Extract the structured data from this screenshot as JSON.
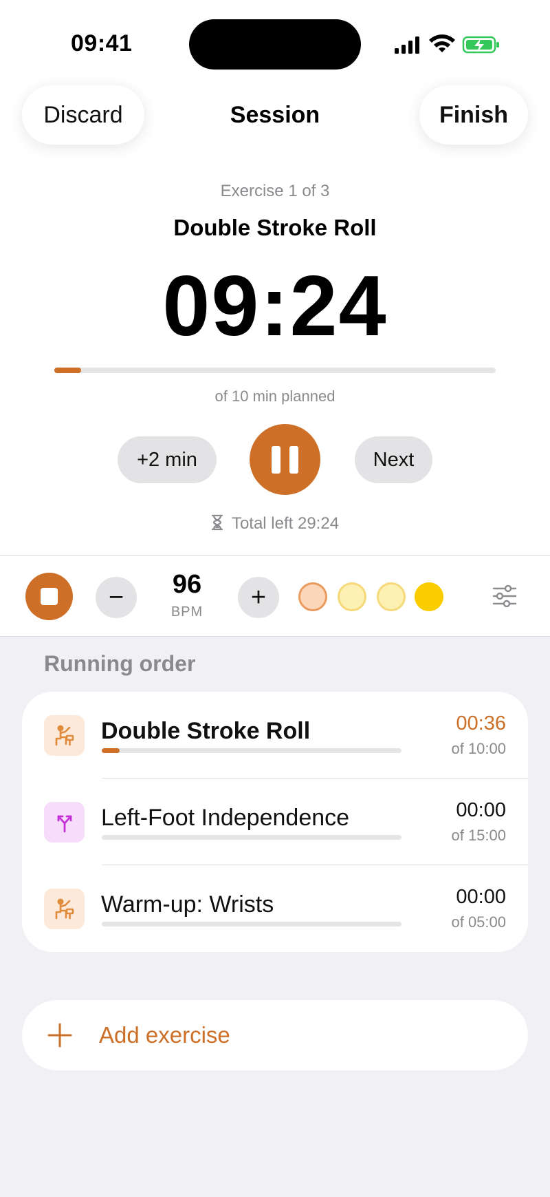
{
  "status_bar": {
    "time": "09:41"
  },
  "nav": {
    "discard_label": "Discard",
    "title": "Session",
    "finish_label": "Finish"
  },
  "current": {
    "counter": "Exercise 1 of 3",
    "name": "Double Stroke Roll",
    "timer": "09:24",
    "progress_fraction": 0.06,
    "planned": "of 10 min planned",
    "add_time_label": "+2 min",
    "next_label": "Next",
    "total_left": "Total left 29:24"
  },
  "metronome": {
    "bpm": "96",
    "unit": "BPM",
    "minus_label": "−",
    "plus_label": "+",
    "beats": [
      "accent",
      "normal",
      "normal",
      "current"
    ]
  },
  "running_order": {
    "title": "Running order",
    "items": [
      {
        "name": "Double Stroke Roll",
        "time": "00:36",
        "of": "of 10:00",
        "progress_fraction": 0.06,
        "active": true,
        "icon": "drummer-icon"
      },
      {
        "name": "Left-Foot Independence",
        "time": "00:00",
        "of": "of 15:00",
        "progress_fraction": 0,
        "active": false,
        "icon": "split-arrow-icon"
      },
      {
        "name": "Warm-up: Wrists",
        "time": "00:00",
        "of": "of 05:00",
        "progress_fraction": 0,
        "active": false,
        "icon": "drummer-icon"
      }
    ]
  },
  "add_exercise_label": "Add exercise",
  "colors": {
    "accent": "#cd6f27",
    "background": "#f0f0f5",
    "secondary_text": "#8a8a8e",
    "beat_current": "#fbcc00"
  }
}
